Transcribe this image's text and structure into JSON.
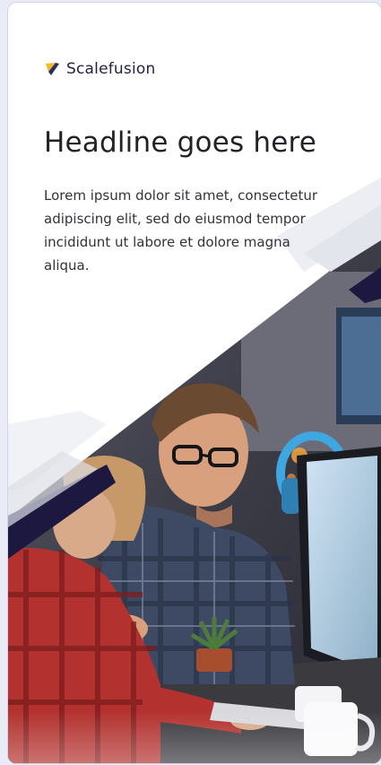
{
  "brand": {
    "name": "Scalefusion",
    "logo_icon": "scalefusion-logo-icon"
  },
  "content": {
    "headline": "Headline goes here",
    "body": "Lorem ipsum dolor sit amet, consectetur adipiscing elit, sed do eiusmod tempor incididunt ut labore et dolore magna aliqua."
  },
  "hero": {
    "image_description": "people-working-at-computers-photo"
  },
  "colors": {
    "brand_dark": "#1c1840",
    "logo_yellow": "#f5b921",
    "logo_navy": "#2a2f62",
    "headline": "#222329",
    "body_text": "#30323c"
  }
}
